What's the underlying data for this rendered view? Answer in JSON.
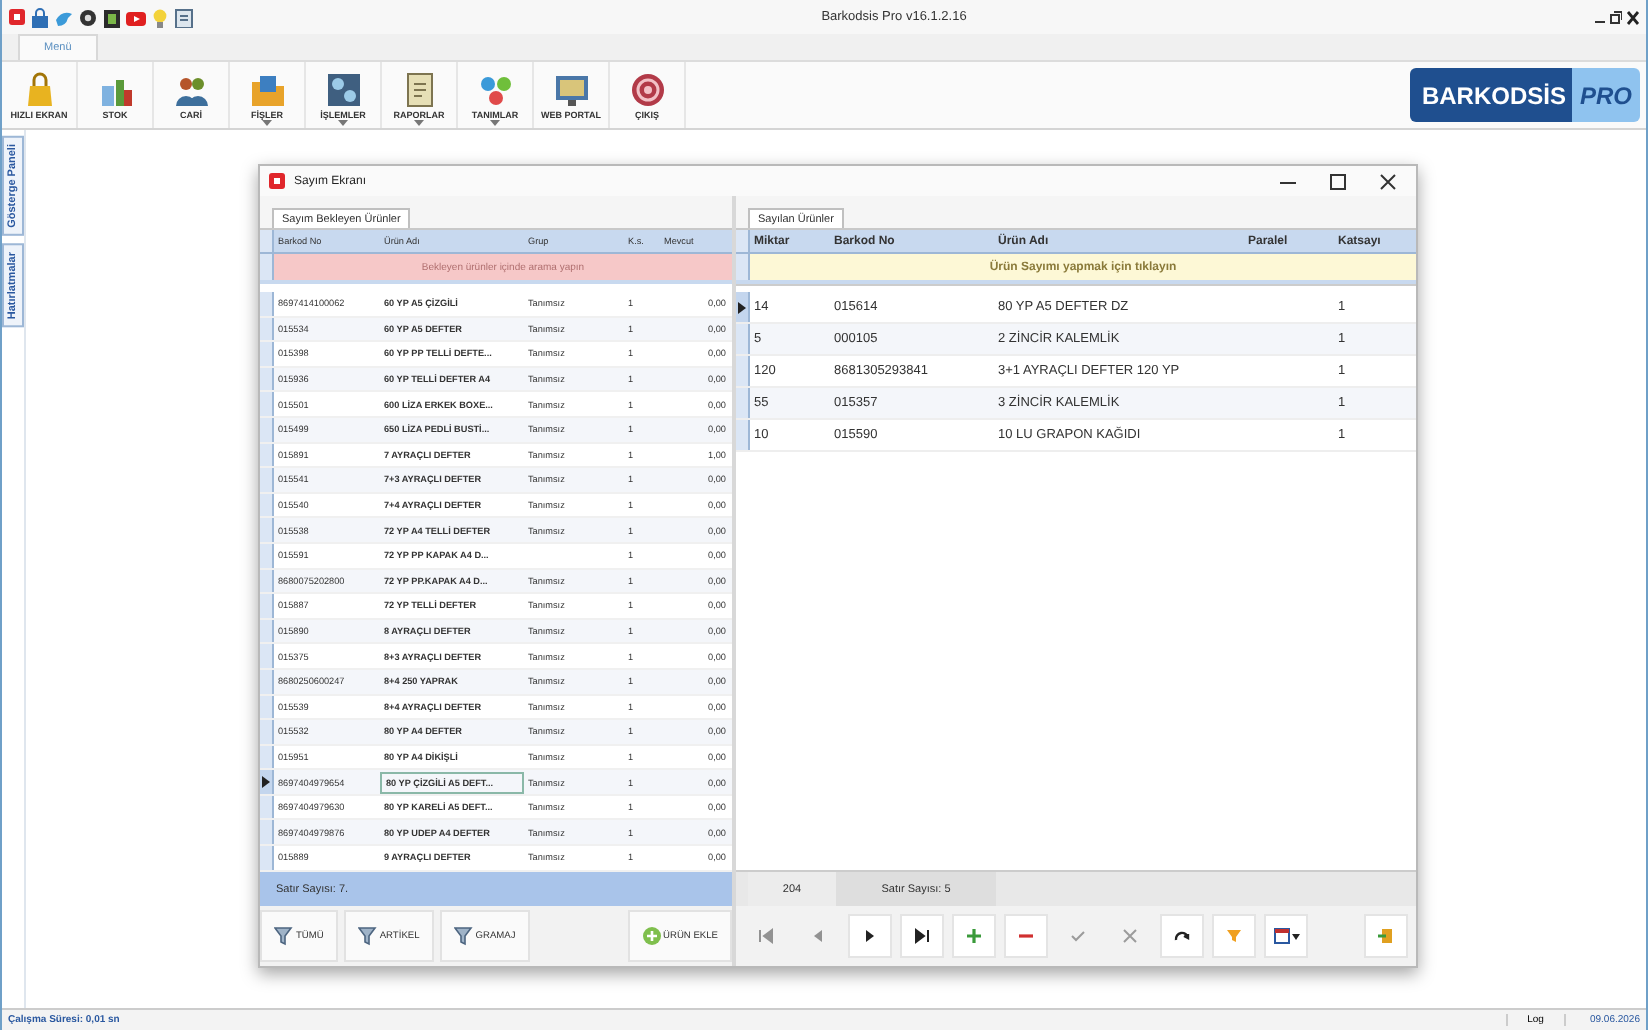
{
  "window": {
    "title": "Barkodsis Pro v16.1.2.16"
  },
  "ribbon": {
    "tabs": [
      {
        "label": "Menü",
        "selected": true
      }
    ],
    "buttons": [
      {
        "label": "HIZLI EKRAN",
        "dropdown": false
      },
      {
        "label": "STOK",
        "dropdown": false
      },
      {
        "label": "CARİ",
        "dropdown": false
      },
      {
        "label": "FİŞLER",
        "dropdown": true
      },
      {
        "label": "İŞLEMLER",
        "dropdown": true
      },
      {
        "label": "RAPORLAR",
        "dropdown": true
      },
      {
        "label": "TANIMLAR",
        "dropdown": true
      },
      {
        "label": "WEB PORTAL",
        "dropdown": false
      },
      {
        "label": "ÇIKIŞ",
        "dropdown": false
      }
    ],
    "logo": {
      "text": "BARKODSİS",
      "suffix": "PRO"
    }
  },
  "side_tabs": [
    {
      "label": "Gösterge Paneli"
    },
    {
      "label": "Hatırlatmalar"
    }
  ],
  "dialog": {
    "title": "Sayım Ekranı",
    "left_panel": {
      "tab": "Sayım Bekleyen Ürünler",
      "columns": [
        "Barkod No",
        "Ürün Adı",
        "Grup",
        "K.s.",
        "Mevcut"
      ],
      "search_placeholder": "Bekleyen ürünler içinde arama yapın",
      "rows": [
        {
          "cells": [
            "8697414100062",
            "60 YP A5 ÇİZGİLİ",
            "Tanımsız",
            "1",
            "0,00"
          ],
          "selected": false
        },
        {
          "cells": [
            "015534",
            "60 YP A5 DEFTER",
            "Tanımsız",
            "1",
            "0,00"
          ],
          "selected": false
        },
        {
          "cells": [
            "015398",
            "60 YP PP TELLİ DEFTE...",
            "Tanımsız",
            "1",
            "0,00"
          ],
          "selected": false
        },
        {
          "cells": [
            "015936",
            "60 YP TELLİ DEFTER A4",
            "Tanımsız",
            "1",
            "0,00"
          ],
          "selected": false
        },
        {
          "cells": [
            "015501",
            "600 LİZA ERKEK BOXE...",
            "Tanımsız",
            "1",
            "0,00"
          ],
          "selected": false
        },
        {
          "cells": [
            "015499",
            "650 LİZA PEDLİ BUSTİ...",
            "Tanımsız",
            "1",
            "0,00"
          ],
          "selected": false
        },
        {
          "cells": [
            "015891",
            "7 AYRAÇLI DEFTER",
            "Tanımsız",
            "1",
            "1,00"
          ],
          "selected": false
        },
        {
          "cells": [
            "015541",
            "7+3 AYRAÇLI DEFTER",
            "Tanımsız",
            "1",
            "0,00"
          ],
          "selected": false
        },
        {
          "cells": [
            "015540",
            "7+4 AYRAÇLI DEFTER",
            "Tanımsız",
            "1",
            "0,00"
          ],
          "selected": false
        },
        {
          "cells": [
            "015538",
            "72 YP A4 TELLİ DEFTER",
            "Tanımsız",
            "1",
            "0,00"
          ],
          "selected": false
        },
        {
          "cells": [
            "015591",
            "72 YP PP KAPAK A4 D...",
            "",
            "1",
            "0,00"
          ],
          "selected": false
        },
        {
          "cells": [
            "8680075202800",
            "72 YP PP.KAPAK A4 D...",
            "Tanımsız",
            "1",
            "0,00"
          ],
          "selected": false
        },
        {
          "cells": [
            "015887",
            "72 YP TELLİ DEFTER",
            "Tanımsız",
            "1",
            "0,00"
          ],
          "selected": false
        },
        {
          "cells": [
            "015890",
            "8 AYRAÇLI DEFTER",
            "Tanımsız",
            "1",
            "0,00"
          ],
          "selected": false
        },
        {
          "cells": [
            "015375",
            "8+3 AYRAÇLI DEFTER",
            "Tanımsız",
            "1",
            "0,00"
          ],
          "selected": false
        },
        {
          "cells": [
            "8680250600247",
            "8+4 250 YAPRAK",
            "Tanımsız",
            "1",
            "0,00"
          ],
          "selected": false
        },
        {
          "cells": [
            "015539",
            "8+4 AYRAÇLI DEFTER",
            "Tanımsız",
            "1",
            "0,00"
          ],
          "selected": false
        },
        {
          "cells": [
            "015532",
            "80 YP A4 DEFTER",
            "Tanımsız",
            "1",
            "0,00"
          ],
          "selected": false
        },
        {
          "cells": [
            "015951",
            "80 YP A4 DİKİŞLİ",
            "Tanımsız",
            "1",
            "0,00"
          ],
          "selected": false
        },
        {
          "cells": [
            "8697404979654",
            "80 YP ÇİZGİLİ A5 DEFT...",
            "Tanımsız",
            "1",
            "0,00"
          ],
          "selected": true
        },
        {
          "cells": [
            "8697404979630",
            "80 YP KARELİ A5 DEFT...",
            "Tanımsız",
            "1",
            "0,00"
          ],
          "selected": false
        },
        {
          "cells": [
            "8697404979876",
            "80 YP UDEP A4 DEFTER",
            "Tanımsız",
            "1",
            "0,00"
          ],
          "selected": false
        },
        {
          "cells": [
            "015889",
            "9 AYRAÇLI DEFTER",
            "Tanımsız",
            "1",
            "0,00"
          ],
          "selected": false
        }
      ],
      "footer": "Satır Sayısı: 7.",
      "buttons": [
        {
          "label": "TÜMÜ",
          "kind": "filter"
        },
        {
          "label": "ARTİKEL",
          "kind": "filter"
        },
        {
          "label": "GRAMAJ",
          "kind": "filter"
        },
        {
          "label": "ÜRÜN EKLE",
          "kind": "add"
        }
      ]
    },
    "right_panel": {
      "tab": "Sayılan Ürünler",
      "columns": [
        "Miktar",
        "Barkod No",
        "Ürün Adı",
        "Paralel",
        "Katsayı"
      ],
      "search_placeholder": "Ürün Sayımı yapmak için tıklayın",
      "rows": [
        {
          "cells": [
            "14",
            "015614",
            "80 YP A5 DEFTER DZ",
            "",
            "1"
          ],
          "selected": true
        },
        {
          "cells": [
            "5",
            "000105",
            "2 ZİNCİR KALEMLİK",
            "",
            "1"
          ],
          "selected": false
        },
        {
          "cells": [
            "120",
            "8681305293841",
            "3+1 AYRAÇLI DEFTER 120 YP",
            "",
            "1"
          ],
          "selected": false
        },
        {
          "cells": [
            "55",
            "015357",
            "3 ZİNCİR KALEMLİK",
            "",
            "1"
          ],
          "selected": false
        },
        {
          "cells": [
            "10",
            "015590",
            "10 LU GRAPON KAĞIDI",
            "",
            "1"
          ],
          "selected": false
        }
      ],
      "footer": {
        "total": "204",
        "count": "Satır Sayısı: 5"
      },
      "nav": [
        {
          "kind": "first",
          "disabled": true
        },
        {
          "kind": "prev",
          "disabled": true
        },
        {
          "kind": "next",
          "disabled": false
        },
        {
          "kind": "last",
          "disabled": false
        },
        {
          "kind": "add",
          "disabled": false
        },
        {
          "kind": "delete",
          "disabled": false
        },
        {
          "kind": "confirm",
          "disabled": true
        },
        {
          "kind": "cancel",
          "disabled": true
        },
        {
          "kind": "refresh",
          "disabled": false
        },
        {
          "kind": "filter",
          "disabled": false
        },
        {
          "kind": "layout",
          "disabled": false
        },
        {
          "kind": "exit",
          "disabled": false
        }
      ]
    }
  },
  "status_bar": {
    "left": "Çalışma Süresi: 0,01 sn",
    "log": "Log",
    "date": "09.06.2026"
  }
}
